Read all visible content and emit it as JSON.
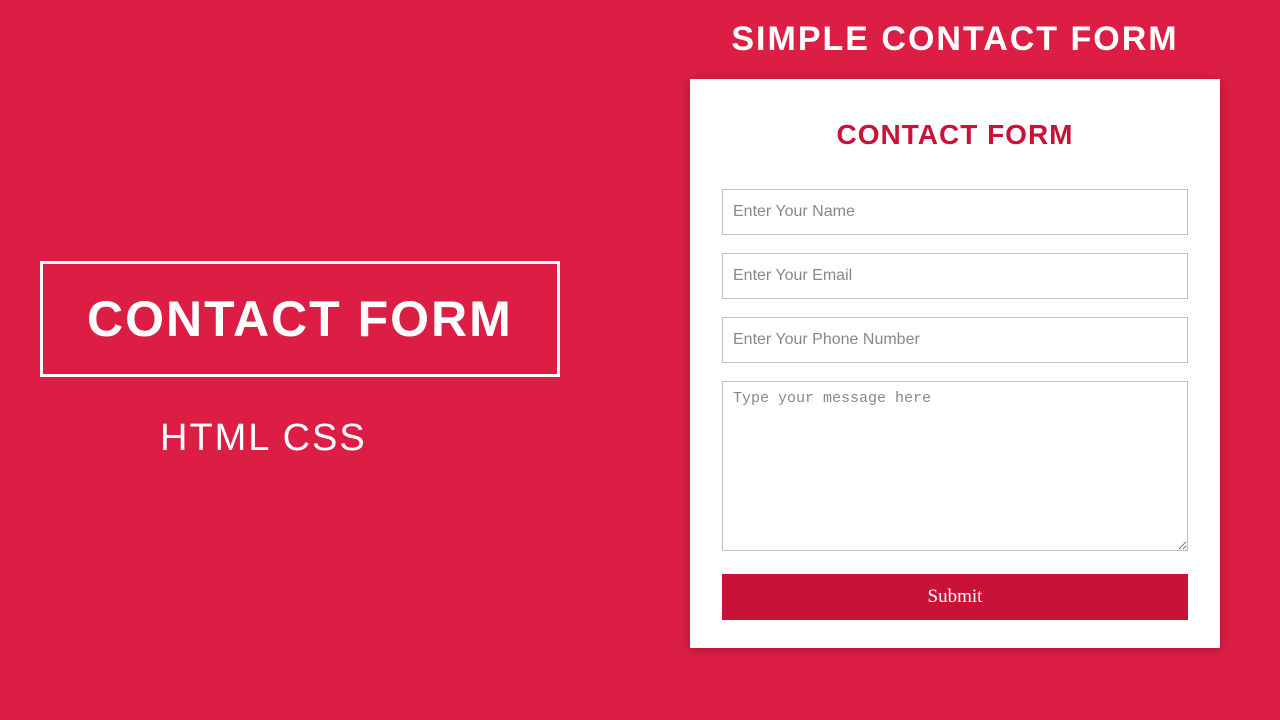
{
  "left": {
    "box_title": "CONTACT FORM",
    "subtitle": "HTML CSS"
  },
  "right": {
    "header": "SIMPLE CONTACT FORM",
    "form": {
      "title": "CONTACT FORM",
      "name_placeholder": "Enter Your Name",
      "email_placeholder": "Enter Your Email",
      "phone_placeholder": "Enter Your Phone Number",
      "message_placeholder": "Type your message here",
      "submit_label": "Submit"
    }
  }
}
